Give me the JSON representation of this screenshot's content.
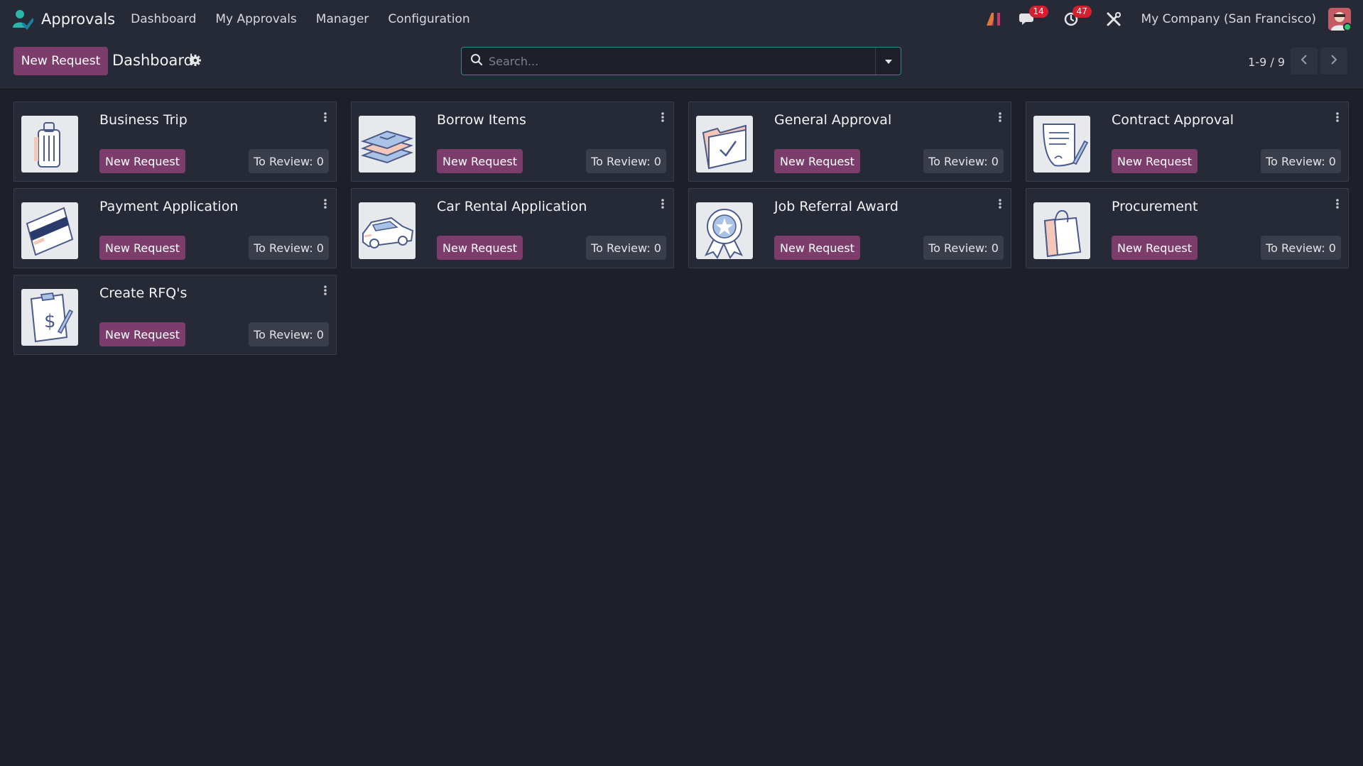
{
  "navbar": {
    "app_name": "Approvals",
    "menu": [
      "Dashboard",
      "My Approvals",
      "Manager",
      "Configuration"
    ],
    "ai_icon_text": "AI",
    "messages_count": "14",
    "activities_count": "47",
    "company": "My Company (San Francisco)"
  },
  "control_panel": {
    "new_request_label": "New Request",
    "title": "Dashboard",
    "search_placeholder": "Search...",
    "pager": "1-9 / 9"
  },
  "cards": [
    {
      "title": "Business Trip",
      "icon": "luggage-icon",
      "new_label": "New Request",
      "review_label": "To Review: 0"
    },
    {
      "title": "Borrow Items",
      "icon": "books-icon",
      "new_label": "New Request",
      "review_label": "To Review: 0"
    },
    {
      "title": "General Approval",
      "icon": "folder-check-icon",
      "new_label": "New Request",
      "review_label": "To Review: 0"
    },
    {
      "title": "Contract Approval",
      "icon": "contract-icon",
      "new_label": "New Request",
      "review_label": "To Review: 0"
    },
    {
      "title": "Payment Application",
      "icon": "credit-card-icon",
      "new_label": "New Request",
      "review_label": "To Review: 0"
    },
    {
      "title": "Car Rental Application",
      "icon": "car-icon",
      "new_label": "New Request",
      "review_label": "To Review: 0"
    },
    {
      "title": "Job Referral Award",
      "icon": "award-ribbon-icon",
      "new_label": "New Request",
      "review_label": "To Review: 0"
    },
    {
      "title": "Procurement",
      "icon": "shopping-bag-icon",
      "new_label": "New Request",
      "review_label": "To Review: 0"
    },
    {
      "title": "Create RFQ's",
      "icon": "clipboard-dollar-icon",
      "new_label": "New Request",
      "review_label": "To Review: 0"
    }
  ],
  "colors": {
    "background": "#1e1f29",
    "navbar": "#262a36",
    "primary": "#7c3d6c",
    "search_border": "#2e8b8b",
    "badge": "#d2202f",
    "online": "#2ecc71"
  }
}
